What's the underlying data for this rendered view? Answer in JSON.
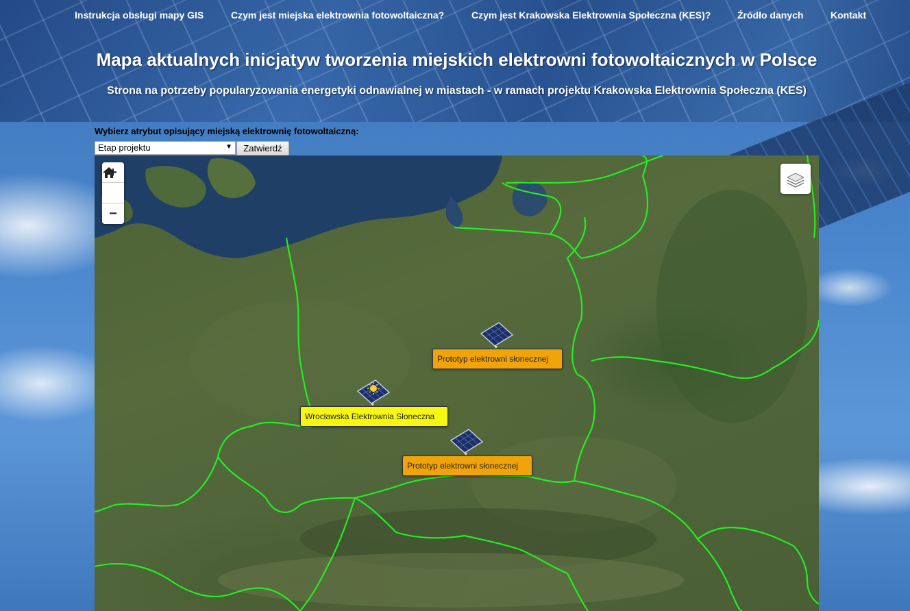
{
  "nav": {
    "items": [
      {
        "label": "Instrukcja obsługi mapy GIS"
      },
      {
        "label": "Czym jest miejska elektrownia fotowoltaiczna?"
      },
      {
        "label": "Czym jest Krakowska Elektrownia Społeczna (KES)?"
      },
      {
        "label": "Źródło danych"
      },
      {
        "label": "Kontakt"
      }
    ]
  },
  "header": {
    "title": "Mapa aktualnych inicjatyw tworzenia miejskich elektrowni fotowoltaicznych w Polsce",
    "subtitle": "Strona na potrzeby popularyzowania energetyki odnawialnej w miastach - w ramach projektu Krakowska Elektrownia Społeczna (KES)"
  },
  "attribute_form": {
    "label": "Wybierz atrybut opisujący miejską elektrownię fotowoltaiczną:",
    "selected": "Etap projektu",
    "submit_label": "Zatwierdź"
  },
  "map": {
    "controls": {
      "zoom_in": "+",
      "home_icon": "home-icon",
      "zoom_out": "−",
      "layers_icon": "layers-icon"
    },
    "markers": [
      {
        "label": "Prototyp elektrowni słonecznej",
        "color": "#f0a30a",
        "icon": "solar-panel-icon"
      },
      {
        "label": "Wrocławska Elektrownia Słoneczna",
        "color": "#f7f712",
        "icon": "solar-panel-sun-icon"
      },
      {
        "label": "Prototyp elektrowni słonecznej",
        "color": "#f0a30a",
        "icon": "solar-panel-icon"
      }
    ],
    "border_color": "#22ee22"
  }
}
